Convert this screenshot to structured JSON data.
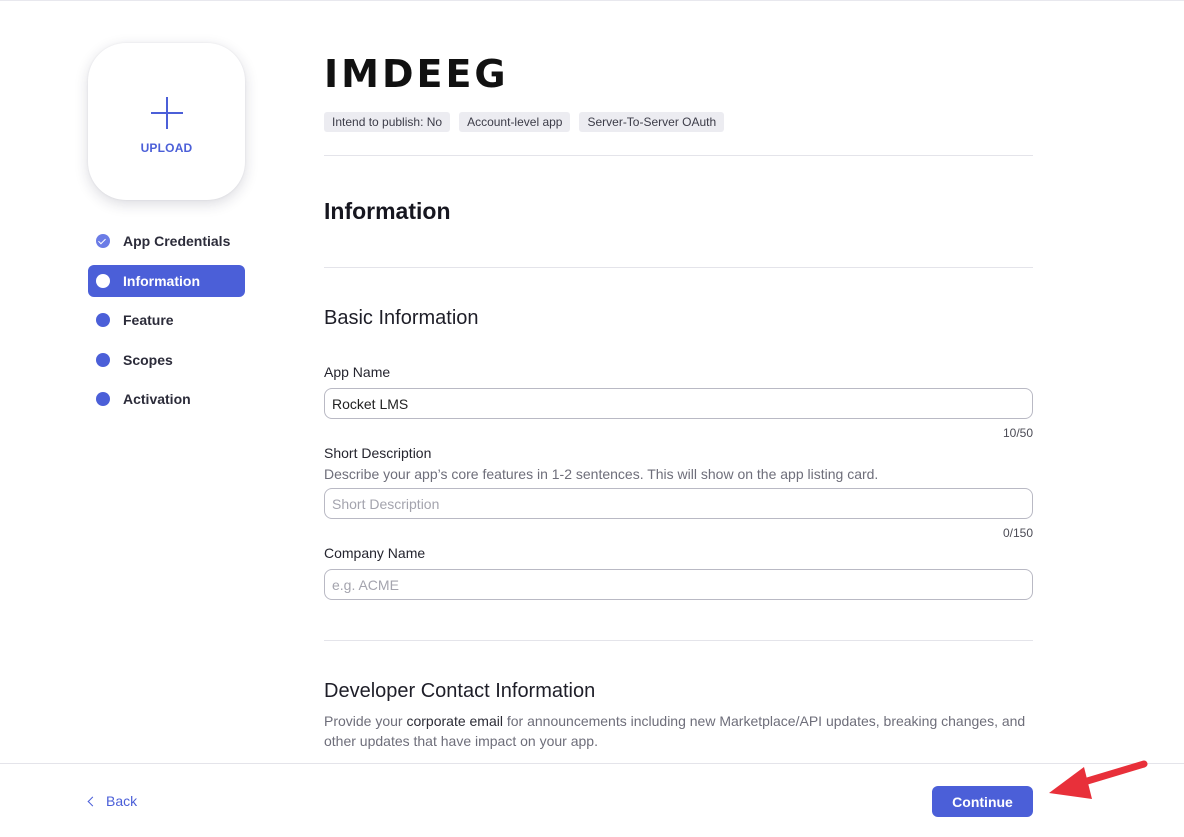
{
  "upload": {
    "label": "UPLOAD"
  },
  "steps": [
    {
      "label": "App Credentials",
      "state": "done"
    },
    {
      "label": "Information",
      "state": "active"
    },
    {
      "label": "Feature",
      "state": "pending"
    },
    {
      "label": "Scopes",
      "state": "pending"
    },
    {
      "label": "Activation",
      "state": "pending"
    }
  ],
  "app": {
    "name": "IMDEEG",
    "tags": [
      "Intend to publish: No",
      "Account-level app",
      "Server-To-Server OAuth"
    ]
  },
  "section": {
    "title": "Information",
    "basic_title": "Basic Information",
    "app_name": {
      "label": "App Name",
      "value": "Rocket LMS",
      "counter": "10/50"
    },
    "short_description": {
      "label": "Short Description",
      "helper": "Describe your app’s core features in 1-2 sentences. This will show on the app listing card.",
      "placeholder": "Short Description",
      "counter": "0/150"
    },
    "company_name": {
      "label": "Company Name",
      "placeholder": "e.g. ACME"
    },
    "developer_title": "Developer Contact Information",
    "developer_helper": {
      "pre": "Provide your ",
      "em": "corporate email",
      "post": " for announcements including new Marketplace/API updates, breaking changes, and other updates that have impact on your app."
    }
  },
  "footer": {
    "back_label": "Back",
    "continue_label": "Continue"
  },
  "colors": {
    "accent": "#4b5fd8",
    "annotation_arrow": "#e8303a"
  },
  "icons": [
    "plus-icon",
    "check-circle-icon",
    "step-dot-icon",
    "chevron-left-icon",
    "red-arrow-annotation"
  ]
}
